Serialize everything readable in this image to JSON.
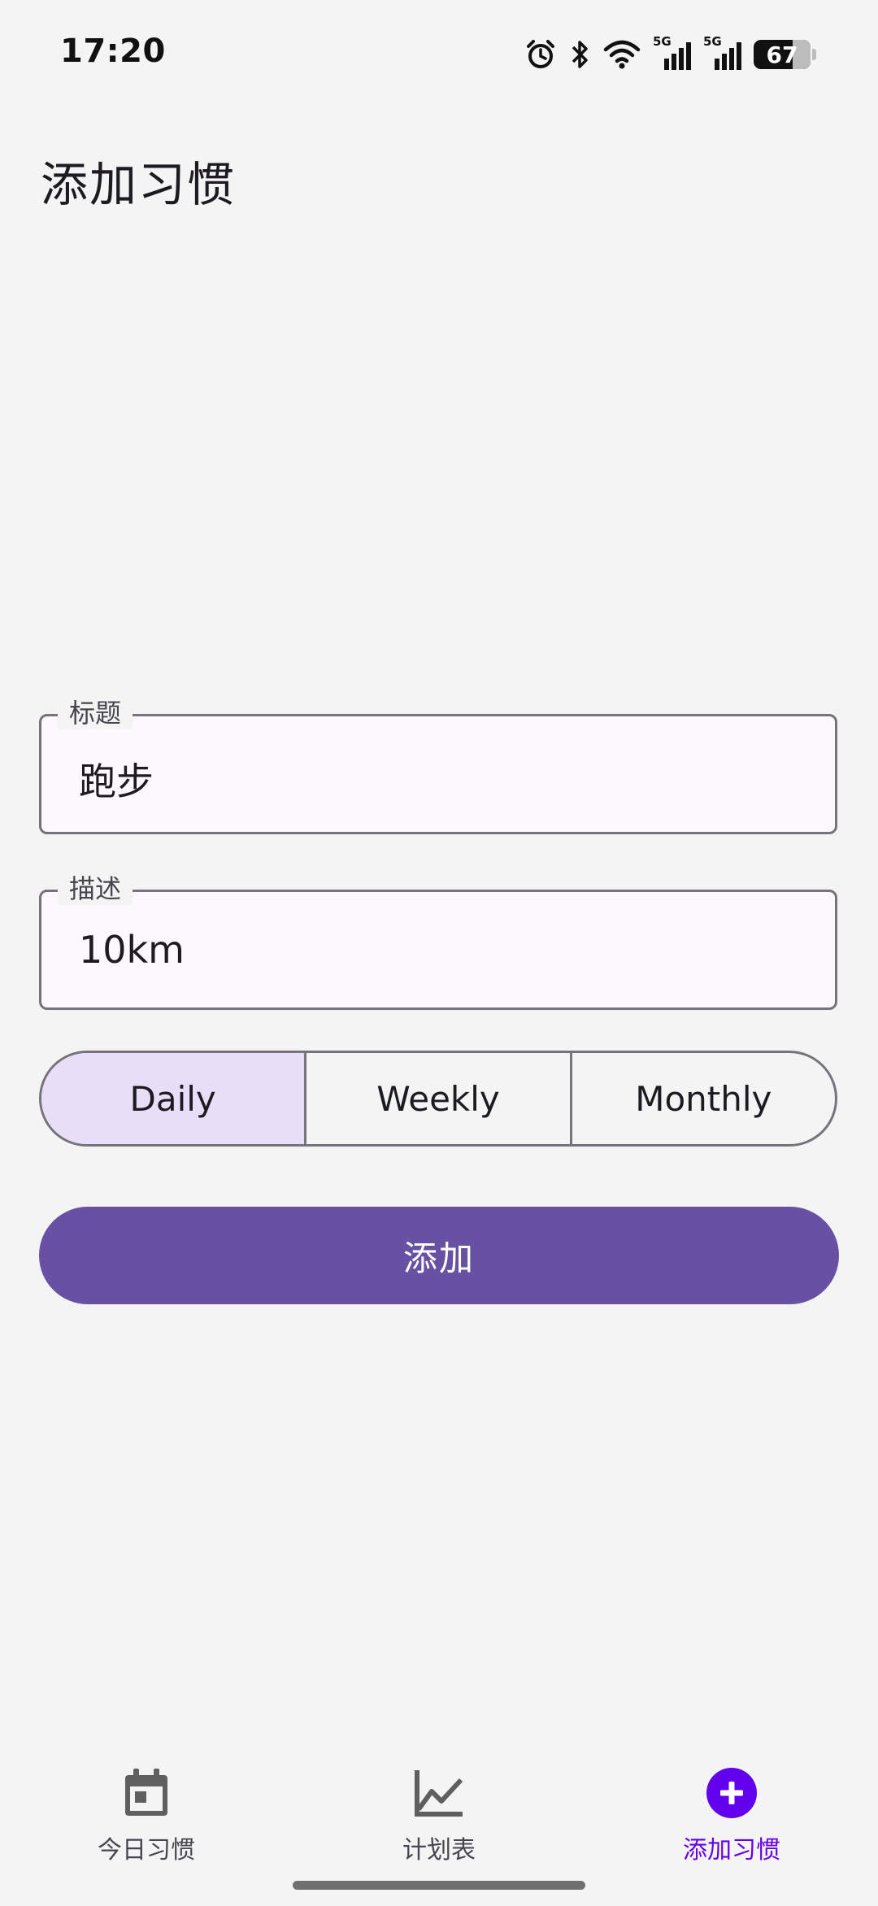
{
  "status_bar": {
    "time": "17:20",
    "battery": "67",
    "network_1": "5G",
    "network_2": "5G"
  },
  "page": {
    "title": "添加习惯"
  },
  "form": {
    "title_field": {
      "label": "标题",
      "value": "跑步"
    },
    "description_field": {
      "label": "描述",
      "value": "10km"
    },
    "frequency": {
      "options": [
        "Daily",
        "Weekly",
        "Monthly"
      ],
      "selected": "Daily"
    },
    "submit_label": "添加"
  },
  "bottom_nav": {
    "items": [
      {
        "label": "今日习惯",
        "icon": "calendar-icon",
        "active": false
      },
      {
        "label": "计划表",
        "icon": "chart-icon",
        "active": false
      },
      {
        "label": "添加习惯",
        "icon": "add-circle-icon",
        "active": true
      }
    ]
  },
  "colors": {
    "primary": "#6851a3",
    "segment_selected": "#e8def8",
    "nav_active": "#6200ee",
    "background": "#f5f4f4"
  }
}
